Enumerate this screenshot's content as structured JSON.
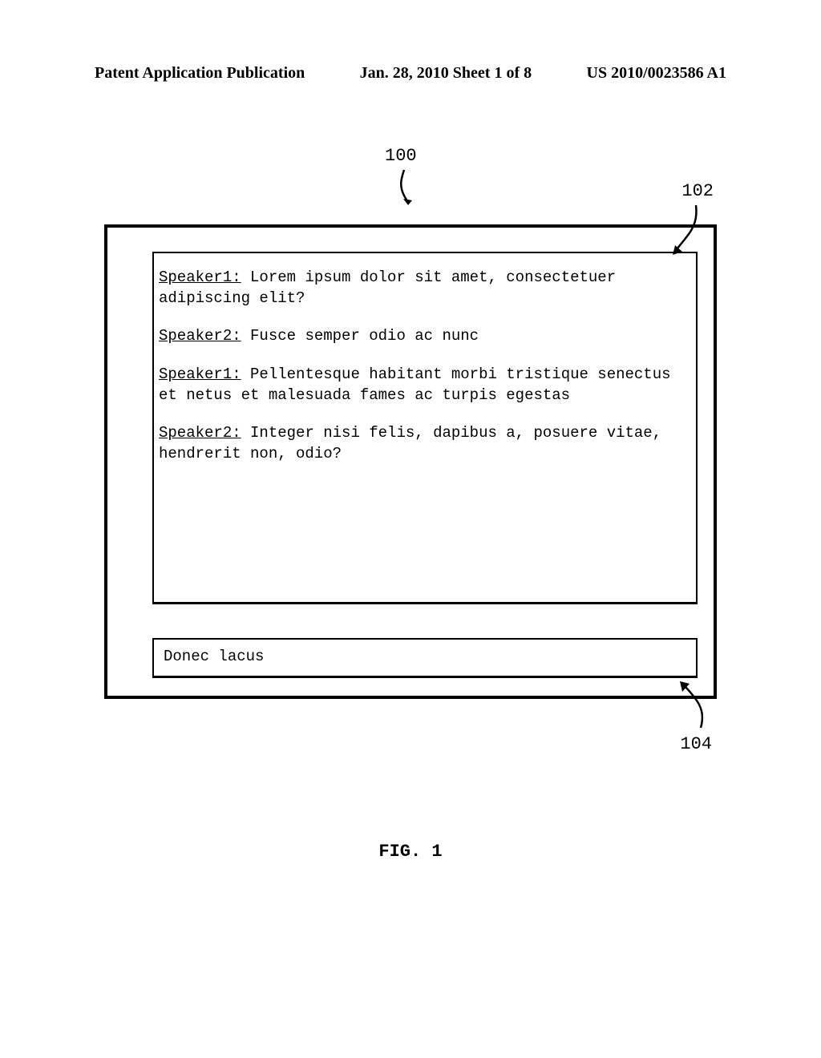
{
  "header": {
    "left": "Patent Application Publication",
    "center": "Jan. 28, 2010  Sheet 1 of 8",
    "right": "US 2010/0023586 A1"
  },
  "refs": {
    "r100": "100",
    "r102": "102",
    "r104": "104"
  },
  "transcript": [
    {
      "speaker": "Speaker1:",
      "text": "  Lorem ipsum dolor sit amet, consectetuer adipiscing elit?"
    },
    {
      "speaker": "Speaker2:",
      "text": "  Fusce semper odio ac nunc"
    },
    {
      "speaker": "Speaker1:",
      "text": "  Pellentesque habitant morbi tristique senectus et netus et malesuada fames ac turpis egestas"
    },
    {
      "speaker": "Speaker2:",
      "text": "  Integer nisi felis, dapibus a, posuere vitae, hendrerit non, odio?"
    }
  ],
  "input": {
    "value": "Donec lacus"
  },
  "figure_label": "FIG. 1"
}
